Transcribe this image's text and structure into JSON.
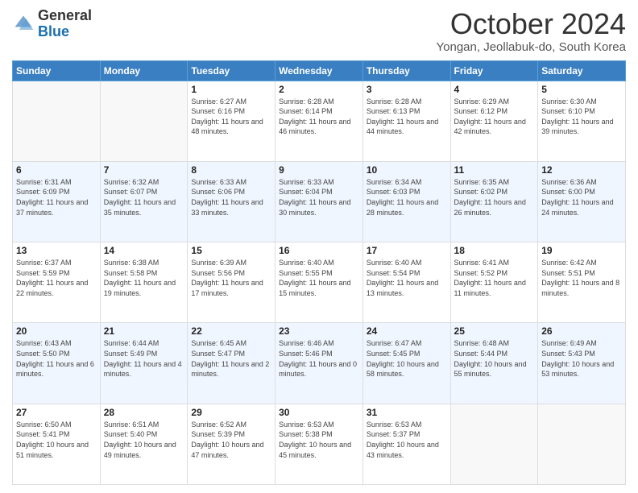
{
  "logo": {
    "general": "General",
    "blue": "Blue"
  },
  "header": {
    "month": "October 2024",
    "location": "Yongan, Jeollabuk-do, South Korea"
  },
  "days_of_week": [
    "Sunday",
    "Monday",
    "Tuesday",
    "Wednesday",
    "Thursday",
    "Friday",
    "Saturday"
  ],
  "weeks": [
    [
      {
        "day": "",
        "empty": true
      },
      {
        "day": "",
        "empty": true
      },
      {
        "day": "1",
        "sunrise": "6:27 AM",
        "sunset": "6:16 PM",
        "daylight": "11 hours and 48 minutes."
      },
      {
        "day": "2",
        "sunrise": "6:28 AM",
        "sunset": "6:14 PM",
        "daylight": "11 hours and 46 minutes."
      },
      {
        "day": "3",
        "sunrise": "6:28 AM",
        "sunset": "6:13 PM",
        "daylight": "11 hours and 44 minutes."
      },
      {
        "day": "4",
        "sunrise": "6:29 AM",
        "sunset": "6:12 PM",
        "daylight": "11 hours and 42 minutes."
      },
      {
        "day": "5",
        "sunrise": "6:30 AM",
        "sunset": "6:10 PM",
        "daylight": "11 hours and 39 minutes."
      }
    ],
    [
      {
        "day": "6",
        "sunrise": "6:31 AM",
        "sunset": "6:09 PM",
        "daylight": "11 hours and 37 minutes."
      },
      {
        "day": "7",
        "sunrise": "6:32 AM",
        "sunset": "6:07 PM",
        "daylight": "11 hours and 35 minutes."
      },
      {
        "day": "8",
        "sunrise": "6:33 AM",
        "sunset": "6:06 PM",
        "daylight": "11 hours and 33 minutes."
      },
      {
        "day": "9",
        "sunrise": "6:33 AM",
        "sunset": "6:04 PM",
        "daylight": "11 hours and 30 minutes."
      },
      {
        "day": "10",
        "sunrise": "6:34 AM",
        "sunset": "6:03 PM",
        "daylight": "11 hours and 28 minutes."
      },
      {
        "day": "11",
        "sunrise": "6:35 AM",
        "sunset": "6:02 PM",
        "daylight": "11 hours and 26 minutes."
      },
      {
        "day": "12",
        "sunrise": "6:36 AM",
        "sunset": "6:00 PM",
        "daylight": "11 hours and 24 minutes."
      }
    ],
    [
      {
        "day": "13",
        "sunrise": "6:37 AM",
        "sunset": "5:59 PM",
        "daylight": "11 hours and 22 minutes."
      },
      {
        "day": "14",
        "sunrise": "6:38 AM",
        "sunset": "5:58 PM",
        "daylight": "11 hours and 19 minutes."
      },
      {
        "day": "15",
        "sunrise": "6:39 AM",
        "sunset": "5:56 PM",
        "daylight": "11 hours and 17 minutes."
      },
      {
        "day": "16",
        "sunrise": "6:40 AM",
        "sunset": "5:55 PM",
        "daylight": "11 hours and 15 minutes."
      },
      {
        "day": "17",
        "sunrise": "6:40 AM",
        "sunset": "5:54 PM",
        "daylight": "11 hours and 13 minutes."
      },
      {
        "day": "18",
        "sunrise": "6:41 AM",
        "sunset": "5:52 PM",
        "daylight": "11 hours and 11 minutes."
      },
      {
        "day": "19",
        "sunrise": "6:42 AM",
        "sunset": "5:51 PM",
        "daylight": "11 hours and 8 minutes."
      }
    ],
    [
      {
        "day": "20",
        "sunrise": "6:43 AM",
        "sunset": "5:50 PM",
        "daylight": "11 hours and 6 minutes."
      },
      {
        "day": "21",
        "sunrise": "6:44 AM",
        "sunset": "5:49 PM",
        "daylight": "11 hours and 4 minutes."
      },
      {
        "day": "22",
        "sunrise": "6:45 AM",
        "sunset": "5:47 PM",
        "daylight": "11 hours and 2 minutes."
      },
      {
        "day": "23",
        "sunrise": "6:46 AM",
        "sunset": "5:46 PM",
        "daylight": "11 hours and 0 minutes."
      },
      {
        "day": "24",
        "sunrise": "6:47 AM",
        "sunset": "5:45 PM",
        "daylight": "10 hours and 58 minutes."
      },
      {
        "day": "25",
        "sunrise": "6:48 AM",
        "sunset": "5:44 PM",
        "daylight": "10 hours and 55 minutes."
      },
      {
        "day": "26",
        "sunrise": "6:49 AM",
        "sunset": "5:43 PM",
        "daylight": "10 hours and 53 minutes."
      }
    ],
    [
      {
        "day": "27",
        "sunrise": "6:50 AM",
        "sunset": "5:41 PM",
        "daylight": "10 hours and 51 minutes."
      },
      {
        "day": "28",
        "sunrise": "6:51 AM",
        "sunset": "5:40 PM",
        "daylight": "10 hours and 49 minutes."
      },
      {
        "day": "29",
        "sunrise": "6:52 AM",
        "sunset": "5:39 PM",
        "daylight": "10 hours and 47 minutes."
      },
      {
        "day": "30",
        "sunrise": "6:53 AM",
        "sunset": "5:38 PM",
        "daylight": "10 hours and 45 minutes."
      },
      {
        "day": "31",
        "sunrise": "6:53 AM",
        "sunset": "5:37 PM",
        "daylight": "10 hours and 43 minutes."
      },
      {
        "day": "",
        "empty": true
      },
      {
        "day": "",
        "empty": true
      }
    ]
  ],
  "labels": {
    "sunrise": "Sunrise:",
    "sunset": "Sunset:",
    "daylight": "Daylight:"
  }
}
